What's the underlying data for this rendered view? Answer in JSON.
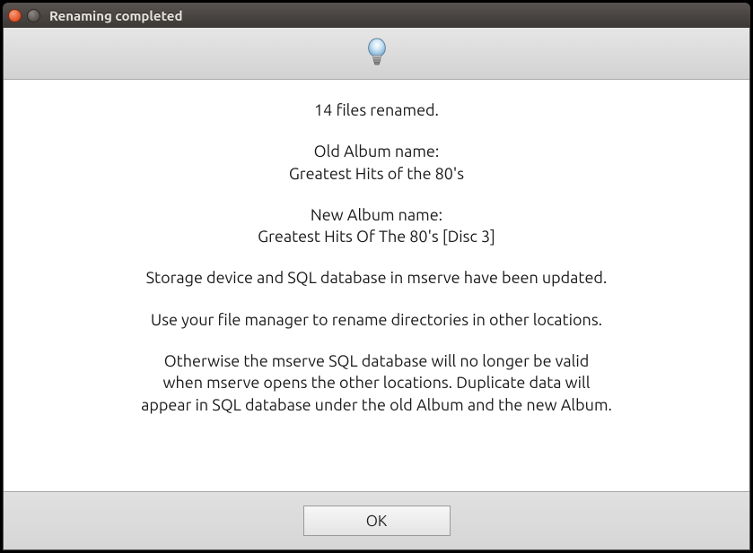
{
  "titlebar": {
    "title": "Renaming completed"
  },
  "icon": {
    "name": "lightbulb-icon"
  },
  "message": {
    "files_renamed": "14 files renamed.",
    "old_label": "Old Album name:",
    "old_value": "Greatest Hits of the 80's",
    "new_label": "New Album name:",
    "new_value": "Greatest Hits Of The 80's [Disc 3]",
    "info1": "Storage device and SQL database in mserve have been updated.",
    "info2": "Use your file manager to rename directories in other locations.",
    "warn1": "Otherwise the mserve SQL database will no longer be valid",
    "warn2": "when mserve opens the other locations. Duplicate data will",
    "warn3": "appear in SQL database under the old Album and the new Album."
  },
  "buttons": {
    "ok": "OK"
  }
}
